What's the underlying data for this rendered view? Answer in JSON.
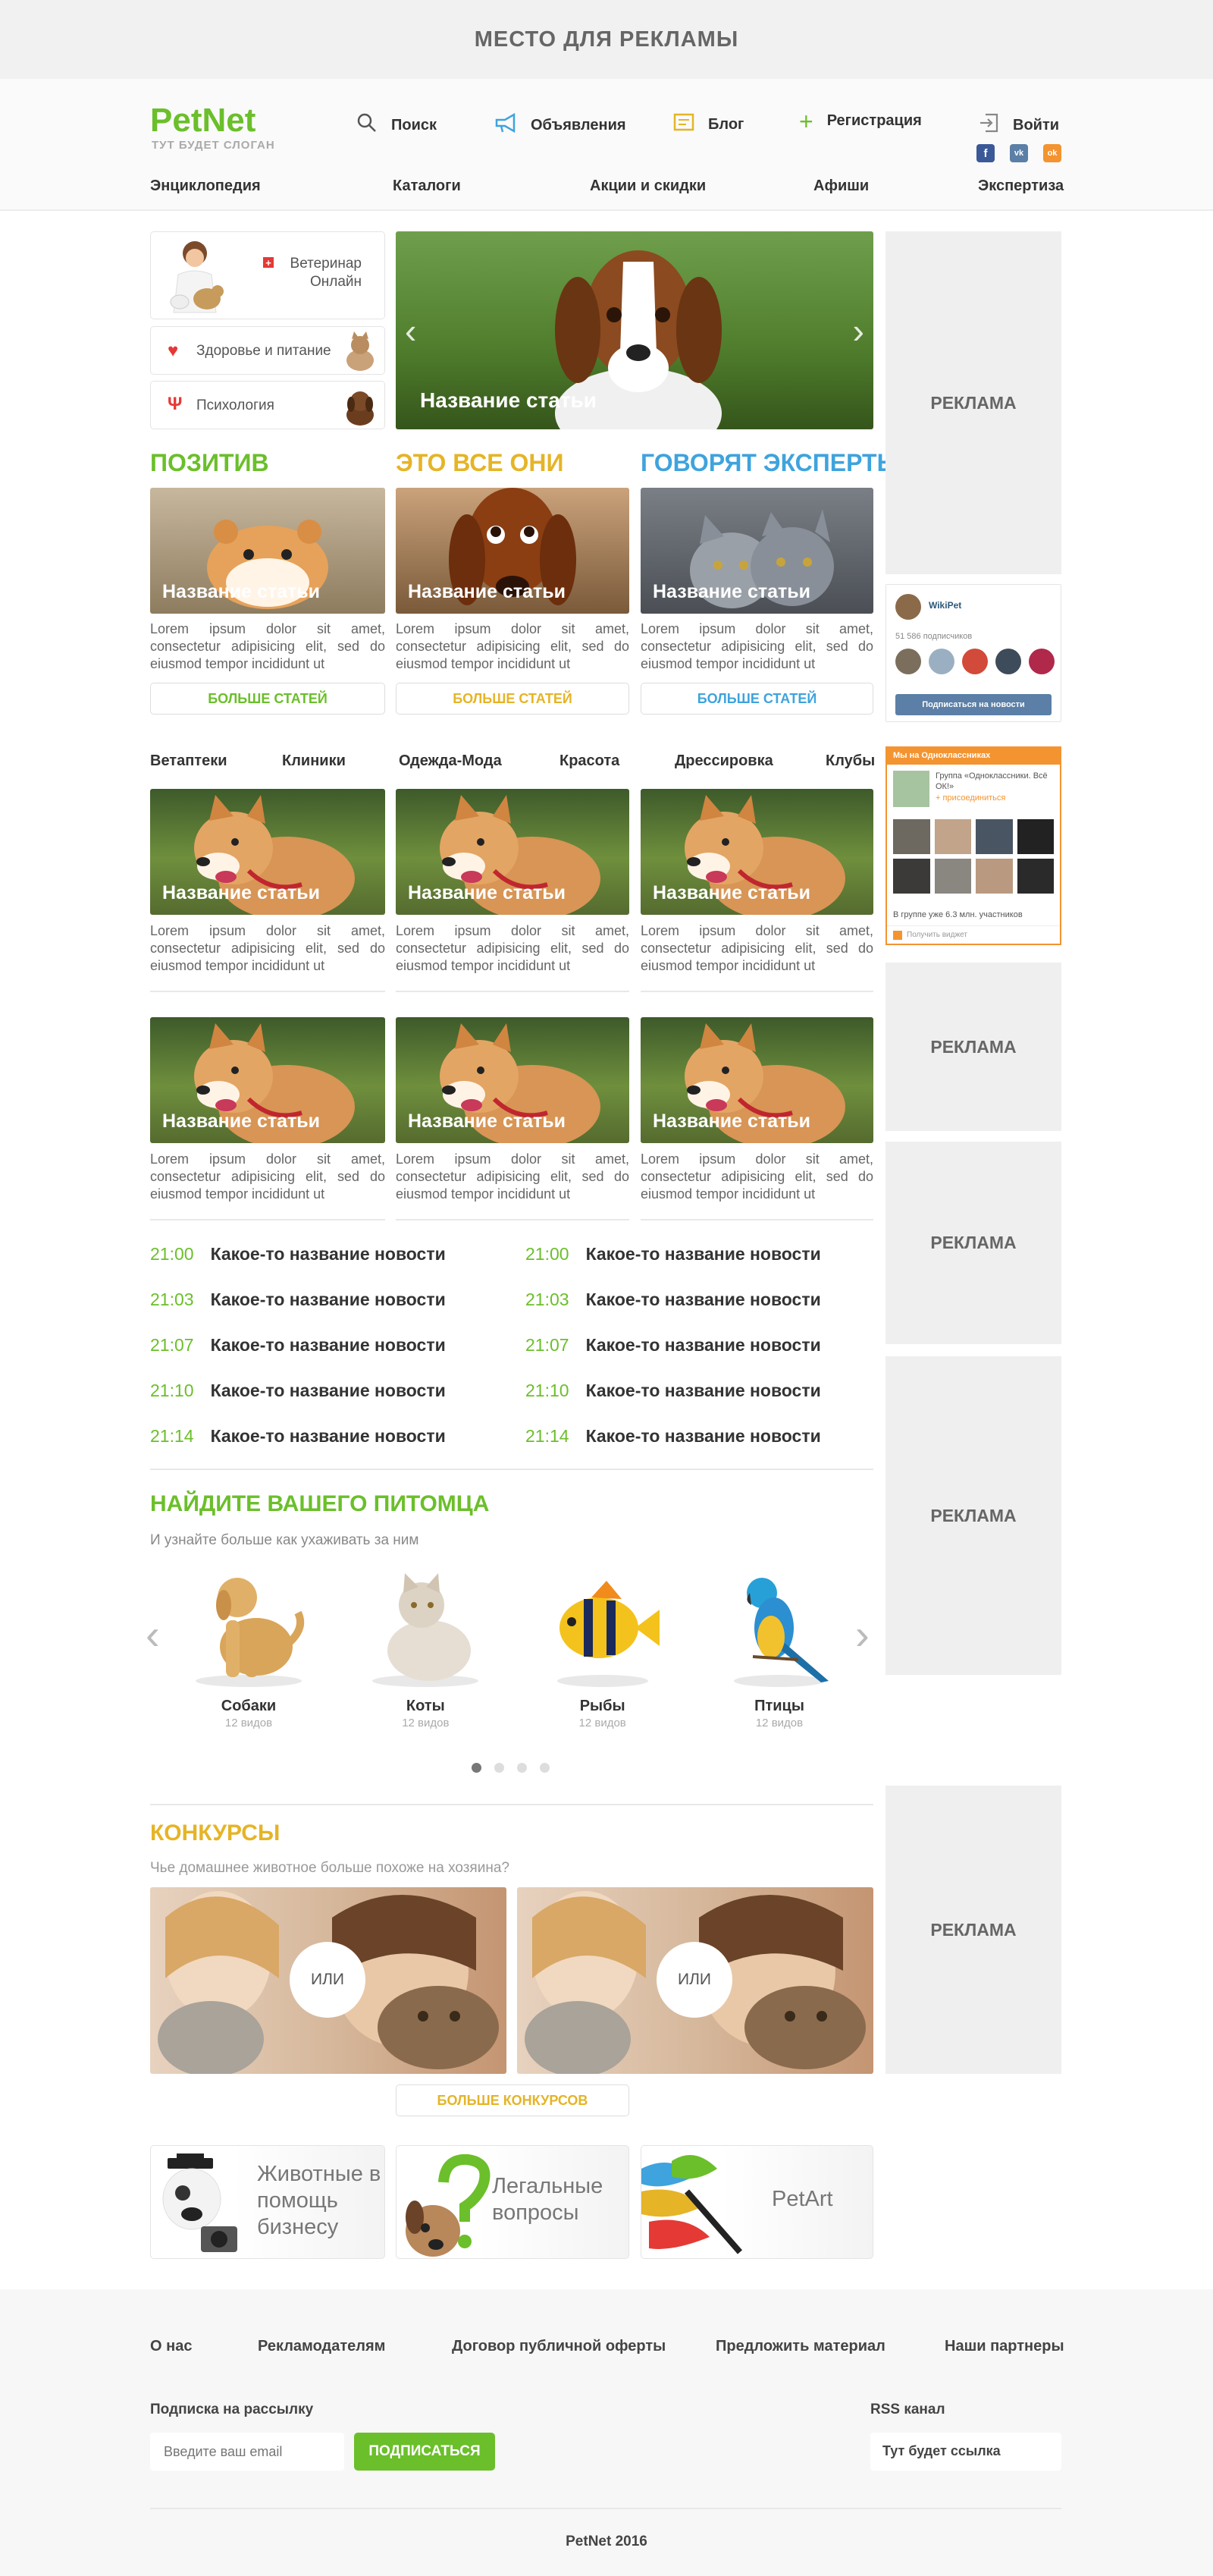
{
  "ad_top": "МЕСТО ДЛЯ РЕКЛАМЫ",
  "logo": "PetNet",
  "slogan": "ТУТ БУДЕТ СЛОГАН",
  "nav": {
    "search": "Поиск",
    "ads": "Объявления",
    "blog": "Блог",
    "register": "Регистрация",
    "login": "Войти"
  },
  "social": {
    "fb": "f",
    "vk": "vk",
    "ok": "ok"
  },
  "categories": [
    "Энциклопедия",
    "Каталоги",
    "Акции и скидки",
    "Афиши",
    "Экспертиза"
  ],
  "side_links": {
    "vet": "Ветеринар Онлайн",
    "health": "Здоровье и питание",
    "psy": "Психология"
  },
  "slider_caption": "Название статьи",
  "sections": [
    {
      "title": "ПОЗИТИВ",
      "color": "#6bbf2a",
      "caption": "Название статьи",
      "text": "Lorem ipsum dolor sit amet, consectetur adipisicing elit, sed do eiusmod tempor incididunt ut",
      "button": "БОЛЬШЕ СТАТЕЙ"
    },
    {
      "title": "ЭТО ВСЕ ОНИ",
      "color": "#e5b427",
      "caption": "Название статьи",
      "text": "Lorem ipsum dolor sit amet, consectetur adipisicing elit, sed do eiusmod tempor incididunt ut",
      "button": "БОЛЬШЕ СТАТЕЙ"
    },
    {
      "title": "ГОВОРЯТ ЭКСПЕРТЫ",
      "color": "#3fa3dd",
      "caption": "Название статьи",
      "text": "Lorem ipsum dolor sit amet, consectetur adipisicing elit, sed do eiusmod tempor incididunt ut",
      "button": "БОЛЬШЕ СТАТЕЙ"
    }
  ],
  "tabs": [
    "Ветаптеки",
    "Клиники",
    "Одежда-Мода",
    "Красота",
    "Дрессировка",
    "Клубы"
  ],
  "grid_card": {
    "caption": "Название статьи",
    "text": "Lorem ipsum dolor sit amet, consectetur adipisicing elit, sed do eiusmod tempor incididunt ut"
  },
  "news": [
    {
      "time": "21:00",
      "title": "Какое-то название новости"
    },
    {
      "time": "21:03",
      "title": "Какое-то название новости"
    },
    {
      "time": "21:07",
      "title": "Какое-то название новости"
    },
    {
      "time": "21:10",
      "title": "Какое-то название новости"
    },
    {
      "time": "21:14",
      "title": "Какое-то название новости"
    }
  ],
  "find_pet": {
    "title": "НАЙДИТЕ ВАШЕГО ПИТОМЦА",
    "subtitle": "И узнайте больше как ухаживать за ним"
  },
  "pets": [
    {
      "name": "Собаки",
      "count": "12 видов"
    },
    {
      "name": "Коты",
      "count": "12 видов"
    },
    {
      "name": "Рыбы",
      "count": "12 видов"
    },
    {
      "name": "Птицы",
      "count": "12 видов"
    }
  ],
  "contests": {
    "title": "КОНКУРСЫ",
    "subtitle": "Чье домашнее животное больше похоже на хозяина?",
    "or": "ИЛИ",
    "button": "БОЛЬШЕ КОНКУРСОВ"
  },
  "promos": [
    "Животные в помощь бизнесу",
    "Легальные вопросы",
    "PetArt"
  ],
  "ad_label": "РЕКЛАМА",
  "vk": {
    "name": "WikiPet",
    "subs": "51 586 подписчиков",
    "button": "Подписаться на новости"
  },
  "ok": {
    "header": "Мы на Одноклассниках",
    "group": "Группа «Одноклассники. Всё ОК!»",
    "join": "+ присоединиться",
    "members": "В группе уже 6.3 млн. участников",
    "widget": "Получить виджет"
  },
  "footer": {
    "links": [
      "О нас",
      "Рекламодателям",
      "Договор публичной оферты",
      "Предложить материал",
      "Наши партнеры"
    ],
    "subscribe_label": "Подписка на рассылку",
    "email_placeholder": "Введите ваш email",
    "subscribe_button": "ПОДПИСАТЬСЯ",
    "rss_label": "RSS канал",
    "rss_link": "Тут будет ссылка",
    "copyright": "PetNet 2016"
  },
  "colors": {
    "green": "#6bbf2a",
    "yellow": "#e5b427",
    "blue": "#3fa3dd",
    "ok_orange": "#f39431",
    "vk_blue": "#5b7fa6"
  }
}
